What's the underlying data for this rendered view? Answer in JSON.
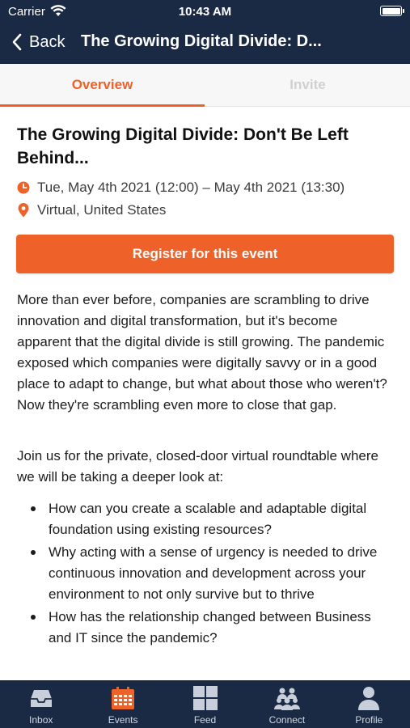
{
  "status_bar": {
    "carrier": "Carrier",
    "time": "10:43 AM"
  },
  "nav": {
    "back_label": "Back",
    "title": "The Growing Digital Divide: D..."
  },
  "tabs": [
    {
      "label": "Overview",
      "active": true
    },
    {
      "label": "Invite",
      "active": false
    }
  ],
  "event": {
    "title": "The Growing Digital Divide: Don't Be Left Behind...",
    "date": "Tue, May 4th 2021 (12:00) – May 4th 2021 (13:30)",
    "location": "Virtual, United States",
    "register_label": "Register for this event",
    "description_p1": "More than ever before, companies are scrambling to drive innovation and digital transformation, but it's become apparent that the digital divide is still growing. The pandemic exposed which companies were digitally savvy or in a good place to adapt to change, but what about those who weren't? Now they're scrambling even more to close that gap.",
    "description_p2": "Join us for the private, closed-door virtual roundtable where we will be taking a deeper look at:",
    "bullets": [
      "How can you create a scalable and adaptable digital foundation using existing resources?",
      "Why acting with a sense of urgency is needed to drive continuous innovation and development across your environment to not only survive but to thrive",
      "How has the relationship changed between Business and IT since the pandemic?"
    ]
  },
  "tab_bar": [
    {
      "label": "Inbox",
      "icon": "inbox-icon"
    },
    {
      "label": "Events",
      "icon": "calendar-icon",
      "active": true
    },
    {
      "label": "Feed",
      "icon": "grid-icon"
    },
    {
      "label": "Connect",
      "icon": "people-icon"
    },
    {
      "label": "Profile",
      "icon": "profile-icon"
    }
  ],
  "colors": {
    "header_bg": "#1b2a44",
    "accent": "#ee6229",
    "inactive_tab": "#d0d0d0"
  }
}
